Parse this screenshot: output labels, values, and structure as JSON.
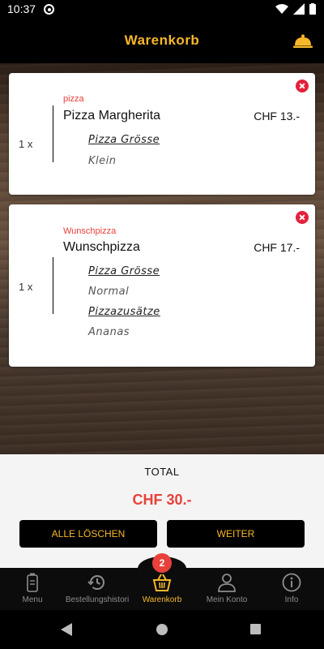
{
  "status": {
    "time": "10:37"
  },
  "header": {
    "title": "Warenkorb"
  },
  "cart": {
    "items": [
      {
        "quantity": "1 x",
        "category": "pizza",
        "name": "Pizza Margherita",
        "price": "CHF 13.-",
        "options": [
          {
            "heading": "Pizza Grösse",
            "value": "Klein"
          }
        ]
      },
      {
        "quantity": "1 x",
        "category": "Wunschpizza",
        "name": "Wunschpizza",
        "price": "CHF 17.-",
        "options": [
          {
            "heading": "Pizza Grösse",
            "value": "Normal"
          },
          {
            "heading": "Pizzazusätze ",
            "value": "Ananas"
          }
        ]
      }
    ]
  },
  "total": {
    "label": "TOTAL",
    "amount": "CHF 30.-"
  },
  "actions": {
    "clear_label": "ALLE LÖSCHEN",
    "next_label": "WEITER"
  },
  "bottom_nav": {
    "badge_count": "2",
    "items": [
      {
        "label": "Menu",
        "icon": "menu-phone-icon"
      },
      {
        "label": "Bestellungshistori",
        "icon": "history-icon"
      },
      {
        "label": "Warenkorb",
        "icon": "basket-icon",
        "active": true
      },
      {
        "label": "Mein Konto",
        "icon": "user-icon"
      },
      {
        "label": "Info",
        "icon": "info-icon"
      }
    ]
  },
  "colors": {
    "accent": "#f6b72b",
    "danger": "#e8403a",
    "remove": "#e4213a"
  }
}
